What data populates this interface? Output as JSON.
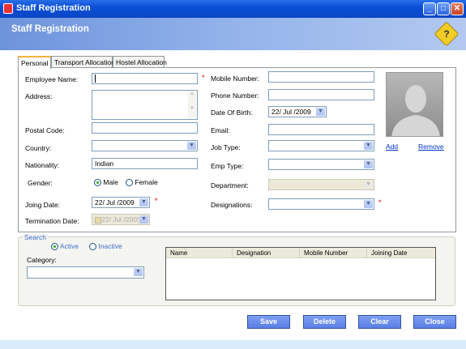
{
  "window": {
    "title": "Staff Registration"
  },
  "header": {
    "title": "Staff Registration"
  },
  "tabs": [
    "Personal",
    "Transport Allocation",
    "Hostel Allocation"
  ],
  "personal": {
    "employee_name": {
      "label": "Employee Name:",
      "value": ""
    },
    "address": {
      "label": "Address:",
      "value": ""
    },
    "postal_code": {
      "label": "Postal Code:",
      "value": ""
    },
    "country": {
      "label": "Country:",
      "value": ""
    },
    "nationality": {
      "label": "Nationality:",
      "value": "Indian"
    },
    "gender": {
      "label": "Gender:",
      "options": [
        "Male",
        "Female"
      ],
      "selected": "Male"
    },
    "joining_date": {
      "label": "Joing Date:",
      "value": "22/ Jul /2009"
    },
    "termination_date": {
      "label": "Termination Date:",
      "value": "22/ Jul /200!"
    },
    "mobile": {
      "label": "Mobile Number:",
      "value": ""
    },
    "phone": {
      "label": "Phone Number:",
      "value": ""
    },
    "dob": {
      "label": "Date Of Birth:",
      "value": "22/ Jul /2009"
    },
    "email": {
      "label": "Email:",
      "value": ""
    },
    "job_type": {
      "label": "Job Type:",
      "value": ""
    },
    "emp_type": {
      "label": "Emp Type:",
      "value": ""
    },
    "department": {
      "label": "Department:",
      "value": ""
    },
    "designations": {
      "label": "Designations:",
      "value": ""
    },
    "required_mark": "*",
    "photo_add": "Add",
    "photo_remove": "Remove"
  },
  "search": {
    "title": "Search",
    "status_options": [
      "Active",
      "Inactive"
    ],
    "status_selected": "Active",
    "category_label": "Category:",
    "category_value": "",
    "columns": [
      "Name",
      "Designation",
      "Mobile Number",
      "Joining Date"
    ],
    "rows": []
  },
  "buttons": {
    "save": "Save",
    "delete": "Delete",
    "clear": "Clear",
    "close": "Close"
  },
  "colors": {
    "accent": "#5a7fe6",
    "required": "#e00000"
  }
}
